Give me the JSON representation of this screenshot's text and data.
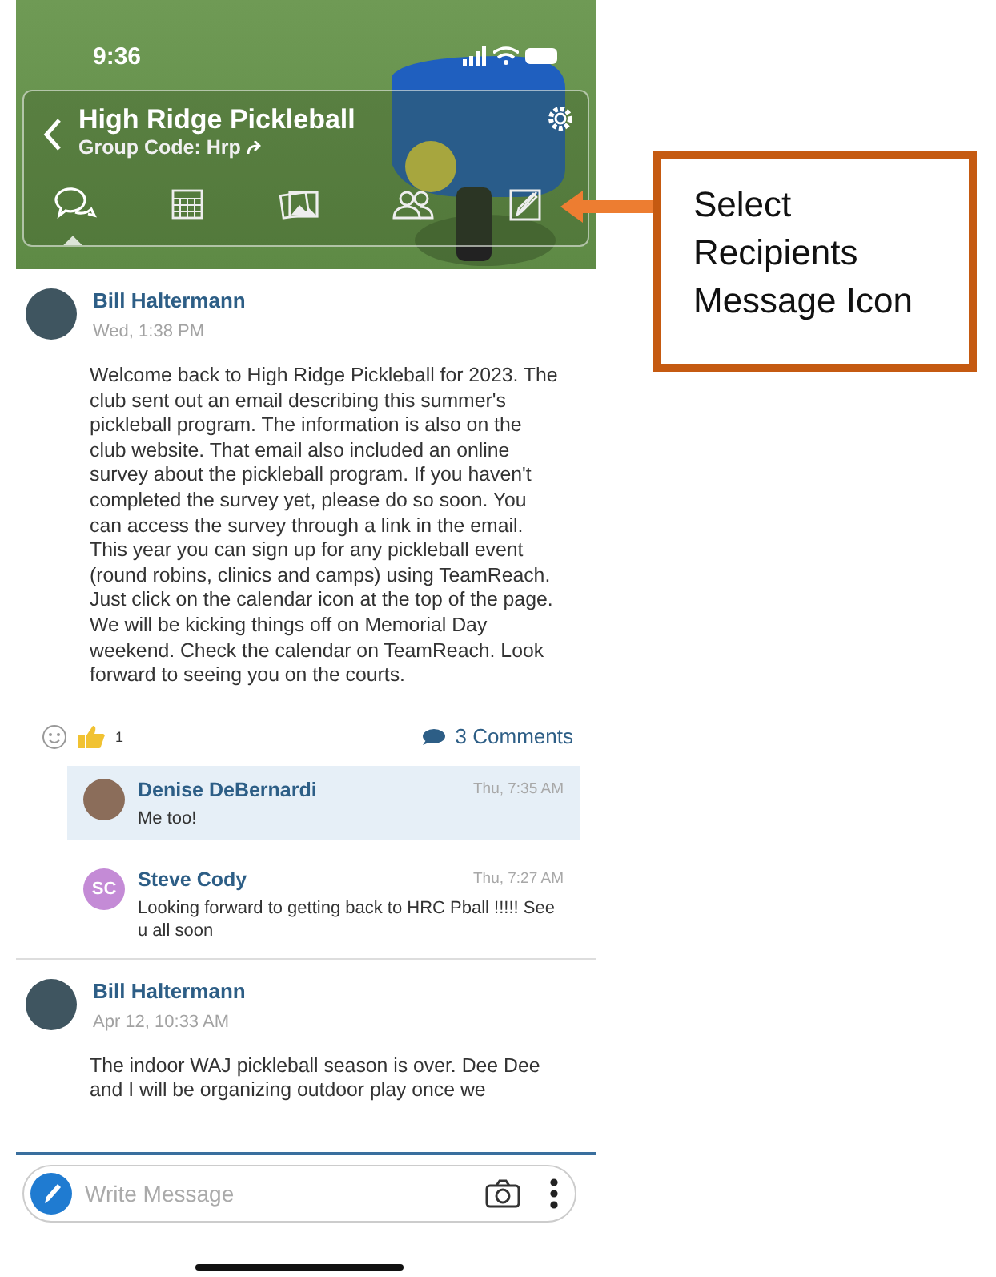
{
  "status_bar": {
    "time": "9:36"
  },
  "group": {
    "title": "High Ridge Pickleball",
    "code": "Group Code: Hrp"
  },
  "tabs": [
    {
      "kind": "chat",
      "selected": true
    },
    {
      "kind": "calendar",
      "selected": false
    },
    {
      "kind": "photos",
      "selected": false
    },
    {
      "kind": "members",
      "selected": false
    },
    {
      "kind": "compose",
      "selected": false
    }
  ],
  "posts": [
    {
      "author": "Bill Haltermann",
      "time": "Wed, 1:38 PM",
      "text": "Welcome back to High Ridge Pickleball for 2023. The club sent out an email describing this summer's pickleball program. The information is also on the club website. That email also included an online survey about the pickleball program. If you haven't completed the survey yet, please do so soon. You can access the survey through a link in the email. This year you can sign up for any pickleball event (round robins, clinics and camps) using TeamReach. Just click on the calendar icon at the top of the page. We will be kicking things off on Memorial Day weekend. Check the calendar on TeamReach. Look forward to seeing you on the courts.",
      "likes": "1",
      "comment_count": "3 Comments",
      "comments": [
        {
          "author": "Denise DeBernardi",
          "time": "Thu, 7:35 AM",
          "text": "Me too!",
          "selected": true
        },
        {
          "initials": "SC",
          "author": "Steve Cody",
          "time": "Thu, 7:27 AM",
          "text": "Looking forward to getting back to HRC Pball !!!!! See u all soon",
          "selected": false
        }
      ]
    },
    {
      "author": "Bill Haltermann",
      "time": "Apr 12, 10:33 AM",
      "text": "The indoor WAJ pickleball season is over. Dee Dee and I will be organizing outdoor play once we"
    }
  ],
  "composer": {
    "placeholder": "Write Message"
  },
  "callout": {
    "lines": [
      "Select",
      "Recipients",
      "Message Icon"
    ]
  }
}
